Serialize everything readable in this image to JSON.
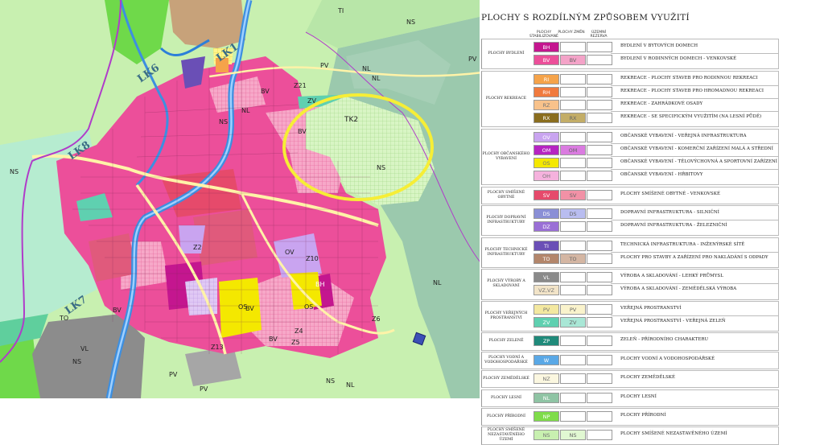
{
  "map": {
    "labels": {
      "lk1": "LK1",
      "lk6": "LK6",
      "lk8": "LK8",
      "lk7": "LK7",
      "tk2": "TK2",
      "z21": "Z21",
      "z2": "Z2",
      "z4": "Z4",
      "z5": "Z5",
      "z6": "Z6",
      "z10": "Z10",
      "z13": "Z13",
      "ns_a": "NS",
      "ns_b": "NS",
      "ns_c": "NS",
      "ns_d": "NS",
      "ns_e": "NS",
      "ns_f": "NS",
      "nl_a": "NL",
      "nl_b": "NL",
      "nl_c": "NL",
      "nl_d": "NL",
      "nl_e": "NL",
      "pv_a": "PV",
      "pv_b": "PV",
      "pv_c": "PV",
      "pv_d": "PV",
      "bv_a": "BV",
      "bv_b": "BV",
      "bv_c": "BV",
      "bv_d": "BV",
      "bv_e": "BV",
      "ov_a": "OV",
      "os_a": "OS",
      "os_b": "OS",
      "vl_a": "VL",
      "zv_a": "ZV",
      "ti_a": "TI",
      "to_a": "TO",
      "bh_a": "BH"
    },
    "highlight_color": "#f6ee36"
  },
  "legend": {
    "title": "PLOCHY S ROZDÍLNÝM ZPŮSOBEM VYUŽITÍ",
    "col_stab": "PLOCHY STABILIZOVANÉ",
    "col_zmen": "PLOCHY ZMĚN",
    "col_rez": "ÚZEMNÍ REZERVA",
    "groups": [
      {
        "label": "PLOCHY BYDLENÍ",
        "rows": [
          {
            "code": "BH",
            "zmen": "",
            "color": "#c4168f",
            "zcolor": "",
            "desc": "BYDLENÍ V BYTOVÝCH DOMECH"
          },
          {
            "code": "BV",
            "zmen": "BV",
            "color": "#ec4f9a",
            "zcolor": "#f4a3c8",
            "desc": "BYDLENÍ V RODINNÝCH DOMECH - VENKOVSKÉ"
          }
        ]
      },
      {
        "label": "PLOCHY REKREACE",
        "rows": [
          {
            "code": "RI",
            "zmen": "",
            "color": "#f5a34a",
            "zcolor": "",
            "desc": "REKREACE - PLOCHY STAVEB PRO RODINNOU REKREACI"
          },
          {
            "code": "RH",
            "zmen": "",
            "color": "#f07a3e",
            "zcolor": "",
            "desc": "REKREACE - PLOCHY STAVEB PRO HROMADNOU REKREACI"
          },
          {
            "code": "RZ",
            "zmen": "",
            "color": "#f8c28b",
            "zcolor": "",
            "desc": "REKREACE - ZAHRÁDKOVÉ OSADY"
          },
          {
            "code": "RX",
            "zmen": "RX",
            "color": "#8a6d1e",
            "zcolor": "#c3ad67",
            "desc": "REKREACE - SE SPECIFICKÝM VYUŽITÍM (NA LESNÍ PŮDĚ)"
          }
        ]
      },
      {
        "label": "PLOCHY OBČANSKÉHO VYBAVENÍ",
        "rows": [
          {
            "code": "OV",
            "zmen": "",
            "color": "#c9a4f0",
            "zcolor": "",
            "desc": "OBČANSKÉ VYBAVENÍ - VEŘEJNÁ INFRASTRUKTURA"
          },
          {
            "code": "OM",
            "zmen": "OM",
            "color": "#b624c2",
            "zcolor": "#da7be0",
            "desc": "OBČANSKÉ VYBAVENÍ - KOMERČNÍ ZAŘÍZENÍ MALÁ A STŘEDNÍ"
          },
          {
            "code": "OS",
            "zmen": "",
            "color": "#f4e800",
            "zcolor": "",
            "desc": "OBČANSKÉ VYBAVENÍ - TĚLOVÝCHOVNÁ A SPORTOVNÍ ZAŘÍZENÍ"
          },
          {
            "code": "OH",
            "zmen": "",
            "color": "#f5b2dd",
            "zcolor": "",
            "desc": "OBČANSKÉ VYBAVENÍ - HŘBITOVY"
          }
        ]
      },
      {
        "label": "PLOCHY SMÍŠENÉ OBYTNÉ",
        "rows": [
          {
            "code": "SV",
            "zmen": "SV",
            "color": "#e64a6b",
            "zcolor": "#f291a6",
            "desc": "PLOCHY SMÍŠENÉ OBYTNÉ - VENKOVSKÉ"
          }
        ]
      },
      {
        "label": "PLOCHY DOPRAVNÍ INFRASTRUKTURY",
        "rows": [
          {
            "code": "DS",
            "zmen": "DS",
            "color": "#8a8fd6",
            "zcolor": "#b9bdf0",
            "desc": "DOPRAVNÍ INFRASTRUKTURA - SILNIČNÍ"
          },
          {
            "code": "DZ",
            "zmen": "",
            "color": "#9a6fd6",
            "zcolor": "",
            "desc": "DOPRAVNÍ INFRASTRUKTURA - ŽELEZNIČNÍ"
          }
        ]
      },
      {
        "label": "PLOCHY TECHNICKÉ INFRASTRUKTURY",
        "rows": [
          {
            "code": "TI",
            "zmen": "",
            "color": "#6a4fb6",
            "zcolor": "",
            "desc": "TECHNICKÁ INFRASTRUKTURA - INŽENÝRSKÉ SÍTĚ"
          },
          {
            "code": "TO",
            "zmen": "TO",
            "color": "#b3866b",
            "zcolor": "#d4b6a3",
            "desc": "PLOCHY PRO STAVBY A ZAŘÍZENÍ PRO NAKLÁDÁNÍ S ODPADY"
          }
        ]
      },
      {
        "label": "PLOCHY VÝROBY A SKLADOVÁNÍ",
        "rows": [
          {
            "code": "VL",
            "zmen": "",
            "color": "#8a8a8a",
            "zcolor": "",
            "desc": "VÝROBA A SKLADOVÁNÍ - LEHKÝ PRŮMYSL"
          },
          {
            "code": "VZ,VZ",
            "zmen": "",
            "color": "#f2e4c8",
            "zcolor": "",
            "desc": "VÝROBA A SKLADOVÁNÍ - ZEMĚDĚLSKÁ VÝROBA"
          }
        ]
      },
      {
        "label": "PLOCHY VEŘEJNÝCH PROSTRANSTVÍ",
        "rows": [
          {
            "code": "PV",
            "zmen": "PV",
            "color": "#f3e8a0",
            "zcolor": "#faf3cc",
            "desc": "VEŘEJNÁ PROSTRANSTVÍ"
          },
          {
            "code": "ZV",
            "zmen": "ZV",
            "color": "#5fd0b0",
            "zcolor": "#a9e7d6",
            "desc": "VEŘEJNÁ PROSTRANSTVÍ - VEŘEJNÁ ZELEŇ"
          }
        ]
      },
      {
        "label": "PLOCHY ZELENĚ",
        "rows": [
          {
            "code": "ZP",
            "zmen": "",
            "color": "#1f8a7a",
            "zcolor": "",
            "desc": "ZELEŇ - PŘÍRODNÍHO CHARAKTERU"
          }
        ]
      },
      {
        "label": "PLOCHY VODNÍ A VODOHOSPODÁŘSKÉ",
        "rows": [
          {
            "code": "W",
            "zmen": "",
            "color": "#5aa8e6",
            "zcolor": "",
            "desc": "PLOCHY VODNÍ A VODOHOSPODÁŘSKÉ"
          }
        ]
      },
      {
        "label": "PLOCHY ZEMĚDĚLSKÉ",
        "rows": [
          {
            "code": "NZ",
            "zmen": "",
            "color": "#fbf7e0",
            "zcolor": "",
            "desc": "PLOCHY ZEMĚDĚLSKÉ"
          }
        ]
      },
      {
        "label": "PLOCHY LESNÍ",
        "rows": [
          {
            "code": "NL",
            "zmen": "",
            "color": "#8fc4a4",
            "zcolor": "",
            "desc": "PLOCHY LESNÍ"
          }
        ]
      },
      {
        "label": "PLOCHY PŘÍRODNÍ",
        "rows": [
          {
            "code": "NP",
            "zmen": "",
            "color": "#7fdc4a",
            "zcolor": "",
            "desc": "PLOCHY PŘÍRODNÍ"
          }
        ]
      },
      {
        "label": "PLOCHY SMÍŠENÉ NEZASTAVĚNÉHO ÚZEMÍ",
        "rows": [
          {
            "code": "NS",
            "zmen": "NS",
            "color": "#c8f0b0",
            "zcolor": "#e1f8d2",
            "desc": "PLOCHY SMÍŠENÉ NEZASTAVĚNÉHO ÚZEMÍ"
          }
        ]
      }
    ]
  }
}
